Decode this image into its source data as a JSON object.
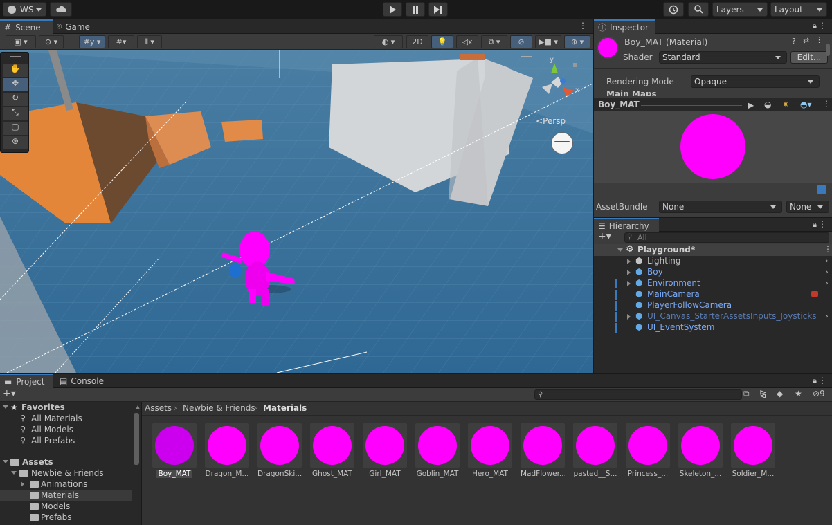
{
  "top_bar": {
    "account_label": "WS",
    "layers_label": "Layers",
    "layout_label": "Layout"
  },
  "scene_panel": {
    "tabs": [
      {
        "label": "Scene"
      },
      {
        "label": "Game"
      }
    ],
    "toolbar_2d_label": "2D",
    "persp_label": "Persp",
    "gizmo_axis_x": "x",
    "gizmo_axis_y": "y"
  },
  "inspector": {
    "tab_label": "Inspector",
    "title": "Boy_MAT (Material)",
    "shader_label": "Shader",
    "shader_value": "Standard",
    "edit_button": "Edit...",
    "rendering_mode_label": "Rendering Mode",
    "rendering_mode_value": "Opaque",
    "main_maps_label": "Main Maps",
    "preview_title": "Boy_MAT",
    "assetbundle_label": "AssetBundle",
    "assetbundle_value": "None",
    "assetbundle_variant": "None",
    "colors": {
      "material": "#ff00ff"
    }
  },
  "hierarchy": {
    "tab_label": "Hierarchy",
    "search_placeholder": "All",
    "scene_name": "Playground*",
    "items": [
      {
        "label": "Lighting",
        "expandable": true,
        "color": "#c4c4c4"
      },
      {
        "label": "Boy",
        "expandable": true,
        "color": "#7baaf7"
      },
      {
        "label": "Environment",
        "expandable": true,
        "color": "#7baaf7"
      },
      {
        "label": "MainCamera",
        "expandable": false,
        "color": "#7baaf7"
      },
      {
        "label": "PlayerFollowCamera",
        "expandable": false,
        "color": "#7baaf7"
      },
      {
        "label": "UI_Canvas_StarterAssetsInputs_Joysticks",
        "expandable": true,
        "color": "#5a7bb0"
      },
      {
        "label": "UI_EventSystem",
        "expandable": false,
        "color": "#7baaf7"
      }
    ]
  },
  "project": {
    "tabs": [
      {
        "label": "Project"
      },
      {
        "label": "Console"
      }
    ],
    "hidden_count": "9",
    "favorites_label": "Favorites",
    "favorites": [
      "All Materials",
      "All Models",
      "All Prefabs"
    ],
    "assets_label": "Assets",
    "tree": [
      {
        "label": "Newbie & Friends"
      },
      {
        "label": "Animations"
      },
      {
        "label": "Materials"
      },
      {
        "label": "Models"
      },
      {
        "label": "Prefabs"
      }
    ],
    "breadcrumb": [
      "Assets",
      "Newbie & Friends",
      "Materials"
    ],
    "assets": [
      {
        "name": "Boy_MAT"
      },
      {
        "name": "Dragon_M..."
      },
      {
        "name": "DragonSki..."
      },
      {
        "name": "Ghost_MAT"
      },
      {
        "name": "Girl_MAT"
      },
      {
        "name": "Goblin_MAT"
      },
      {
        "name": "Hero_MAT"
      },
      {
        "name": "MadFlower..."
      },
      {
        "name": "pasted__S..."
      },
      {
        "name": "Princess_..."
      },
      {
        "name": "Skeleton_..."
      },
      {
        "name": "Soldier_M..."
      }
    ]
  }
}
